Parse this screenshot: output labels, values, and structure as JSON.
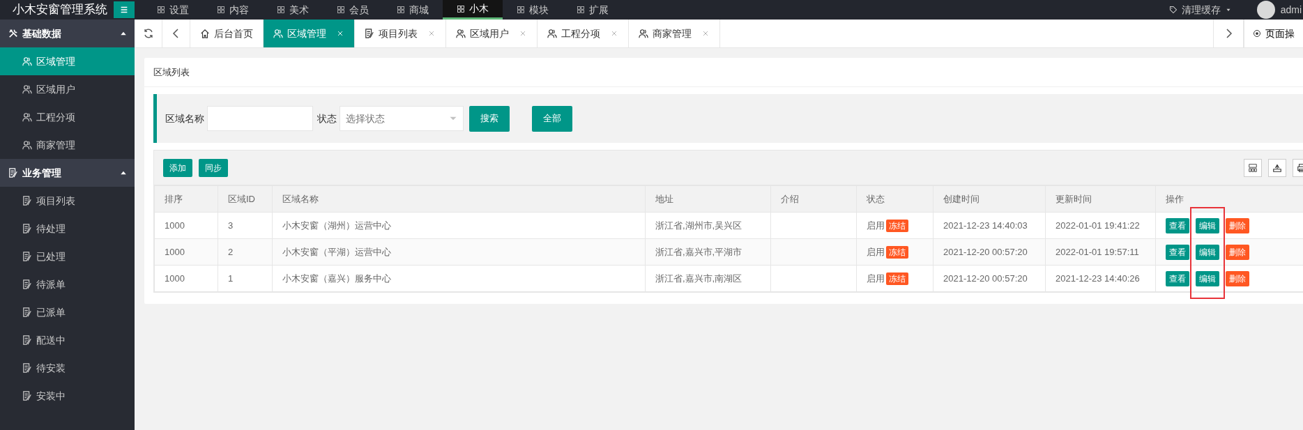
{
  "header": {
    "title": "小木安窗管理系统",
    "nav": [
      {
        "label": "设置",
        "selected": false
      },
      {
        "label": "内容",
        "selected": false
      },
      {
        "label": "美术",
        "selected": false
      },
      {
        "label": "会员",
        "selected": false
      },
      {
        "label": "商城",
        "selected": false
      },
      {
        "label": "小木",
        "selected": true
      },
      {
        "label": "模块",
        "selected": false
      },
      {
        "label": "扩展",
        "selected": false
      }
    ],
    "clear_cache": "清理缓存",
    "user": "admi"
  },
  "sidebar": {
    "groups": [
      {
        "label": "基础数据",
        "kind": "tools",
        "expanded": true,
        "items": [
          {
            "label": "区域管理",
            "kind": "users",
            "selected": true
          },
          {
            "label": "区域用户",
            "kind": "users",
            "selected": false
          },
          {
            "label": "工程分项",
            "kind": "users",
            "selected": false
          },
          {
            "label": "商家管理",
            "kind": "users",
            "selected": false
          }
        ]
      },
      {
        "label": "业务管理",
        "kind": "doc",
        "expanded": true,
        "items": [
          {
            "label": "项目列表",
            "kind": "doc",
            "selected": false
          },
          {
            "label": "待处理",
            "kind": "doc",
            "selected": false
          },
          {
            "label": "已处理",
            "kind": "doc",
            "selected": false
          },
          {
            "label": "待派单",
            "kind": "doc",
            "selected": false
          },
          {
            "label": "已派单",
            "kind": "doc",
            "selected": false
          },
          {
            "label": "配送中",
            "kind": "doc",
            "selected": false
          },
          {
            "label": "待安装",
            "kind": "doc",
            "selected": false
          },
          {
            "label": "安装中",
            "kind": "doc",
            "selected": false
          }
        ]
      }
    ]
  },
  "tabs": [
    {
      "label": "后台首页",
      "kind": "home",
      "closable": false,
      "selected": false
    },
    {
      "label": "区域管理",
      "kind": "users",
      "closable": true,
      "selected": true
    },
    {
      "label": "项目列表",
      "kind": "doc",
      "closable": true,
      "selected": false
    },
    {
      "label": "区域用户",
      "kind": "users",
      "closable": true,
      "selected": false
    },
    {
      "label": "工程分项",
      "kind": "users",
      "closable": true,
      "selected": false
    },
    {
      "label": "商家管理",
      "kind": "users",
      "closable": true,
      "selected": false
    }
  ],
  "page_ops": "页面操",
  "card_title": "区域列表",
  "search": {
    "name_label": "区域名称",
    "status_label": "状态",
    "status_placeholder": "选择状态",
    "buttons": [
      "搜索",
      "全部"
    ]
  },
  "toolbar": {
    "buttons": [
      "添加",
      "同步"
    ]
  },
  "table": {
    "columns": [
      "排序",
      "区域ID",
      "区域名称",
      "地址",
      "介绍",
      "状态",
      "创建时间",
      "更新时间",
      "操作"
    ],
    "rows": [
      {
        "sort": "1000",
        "id": "3",
        "name": "小木安窗（湖州）运营中心",
        "address": "浙江省,湖州市,吴兴区",
        "status": "启用",
        "freeze": "冻结",
        "created": "2021-12-23 14:40:03",
        "updated": "2022-01-01 19:41:22",
        "actions": [
          {
            "label": "查看",
            "kind": "view",
            "highlighted": false
          },
          {
            "label": "编辑",
            "kind": "edit",
            "highlighted": true
          },
          {
            "label": "删除",
            "kind": "delete",
            "highlighted": false
          }
        ]
      },
      {
        "sort": "1000",
        "id": "2",
        "name": "小木安窗（平湖）运营中心",
        "address": "浙江省,嘉兴市,平湖市",
        "status": "启用",
        "freeze": "冻结",
        "created": "2021-12-20 00:57:20",
        "updated": "2022-01-01 19:57:11",
        "actions": [
          {
            "label": "查看",
            "kind": "view",
            "highlighted": false
          },
          {
            "label": "编辑",
            "kind": "edit",
            "highlighted": true
          },
          {
            "label": "删除",
            "kind": "delete",
            "highlighted": false
          }
        ]
      },
      {
        "sort": "1000",
        "id": "1",
        "name": "小木安窗（嘉兴）服务中心",
        "address": "浙江省,嘉兴市,南湖区",
        "status": "启用",
        "freeze": "冻结",
        "created": "2021-12-20 00:57:20",
        "updated": "2021-12-23 14:40:26",
        "actions": [
          {
            "label": "查看",
            "kind": "view",
            "highlighted": false
          },
          {
            "label": "编辑",
            "kind": "edit",
            "highlighted": true
          },
          {
            "label": "删除",
            "kind": "delete",
            "highlighted": false
          }
        ]
      }
    ]
  }
}
